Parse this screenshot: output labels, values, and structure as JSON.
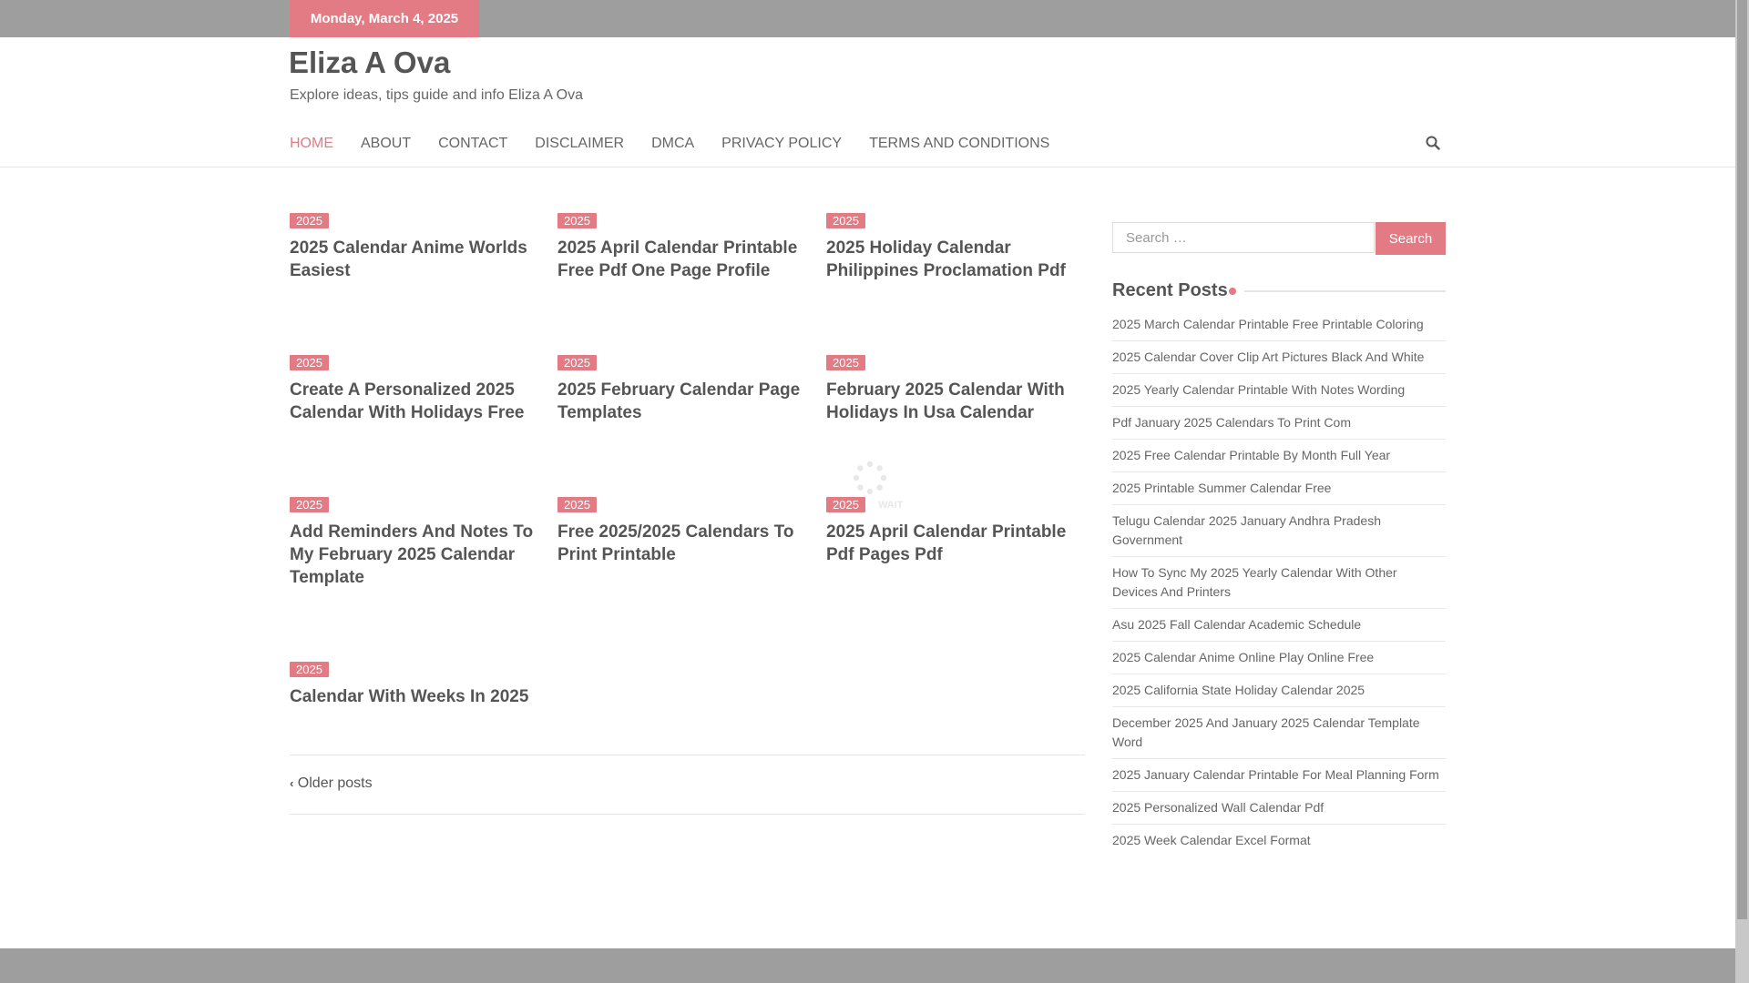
{
  "topbar": {
    "date": "Monday, March 4, 2025"
  },
  "header": {
    "title": "Eliza A Ova",
    "description": "Explore ideas, tips guide and info Eliza A Ova"
  },
  "nav": {
    "items": [
      "HOME",
      "ABOUT",
      "CONTACT",
      "DISCLAIMER",
      "DMCA",
      "PRIVACY POLICY",
      "TERMS AND CONDITIONS"
    ],
    "active": "HOME",
    "search_icon": "search-icon"
  },
  "posts": [
    {
      "tag": "2025",
      "title": "2025 Calendar Anime Worlds Easiest"
    },
    {
      "tag": "2025",
      "title": "2025 April Calendar Printable Free Pdf One Page Profile"
    },
    {
      "tag": "2025",
      "title": "2025 Holiday Calendar Philippines Proclamation Pdf"
    },
    {
      "tag": "2025",
      "title": "Create A Personalized 2025 Calendar With Holidays Free"
    },
    {
      "tag": "2025",
      "title": "2025 February Calendar Page Templates"
    },
    {
      "tag": "2025",
      "title": "February 2025 Calendar With Holidays In Usa Calendar"
    },
    {
      "tag": "2025",
      "title": "Add Reminders And Notes To My February 2025 Calendar Template"
    },
    {
      "tag": "2025",
      "title": "Free 2025/2025 Calendars To Print Printable"
    },
    {
      "tag": "2025",
      "title": "2025 April Calendar Printable Pdf Pages Pdf"
    },
    {
      "tag": "2025",
      "title": "Calendar With Weeks In 2025"
    }
  ],
  "loader_text": "WAIT",
  "pagination": {
    "older": "Older posts"
  },
  "sidebar": {
    "search_placeholder": "Search …",
    "search_button": "Search",
    "recent_title": "Recent Posts",
    "recent_posts": [
      "2025 March Calendar Printable Free Printable Coloring",
      "2025 Calendar Cover Clip Art Pictures Black And White",
      "2025 Yearly Calendar Printable With Notes Wording",
      "Pdf January 2025 Calendars To Print Com",
      "2025 Free Calendar Printable By Month Full Year",
      "2025 Printable Summer Calendar Free",
      "Telugu Calendar 2025 January Andhra Pradesh Government",
      "How To Sync My 2025 Yearly Calendar With Other Devices And Printers",
      "Asu 2025 Fall Calendar Academic Schedule",
      "2025 Calendar Anime Online Play Online Free",
      "2025 California State Holiday Calendar 2025",
      "December 2025 And January 2025 Calendar Template Word",
      "2025 January Calendar Printable For Meal Planning Form",
      "2025 Personalized Wall Calendar Pdf",
      "2025 Week Calendar Excel Format"
    ]
  },
  "colors": {
    "accent": "#e27b84",
    "bar": "#9e9e9e"
  }
}
